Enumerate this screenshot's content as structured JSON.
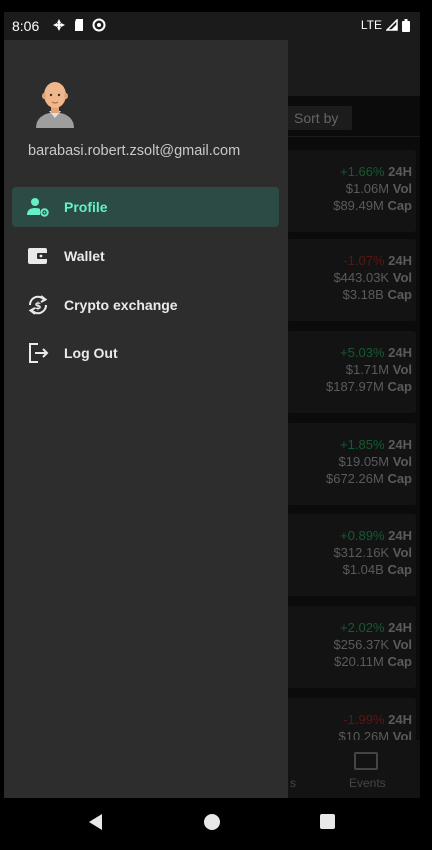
{
  "status_bar": {
    "time": "8:06",
    "network": "LTE"
  },
  "drawer": {
    "email": "barabasi.robert.zsolt@gmail.com",
    "items": [
      {
        "label": "Profile",
        "icon": "profile-settings-icon",
        "active": true
      },
      {
        "label": "Wallet",
        "icon": "wallet-icon",
        "active": false
      },
      {
        "label": "Crypto exchange",
        "icon": "crypto-exchange-icon",
        "active": false
      },
      {
        "label": "Log Out",
        "icon": "logout-icon",
        "active": false
      }
    ]
  },
  "background": {
    "sort_by": "Sort by",
    "cards": [
      {
        "change": "+1.66%",
        "trend": "up",
        "vol": "$1.06M",
        "cap": "$89.49M"
      },
      {
        "change": "-1.07%",
        "trend": "down",
        "vol": "$443.03K",
        "cap": "$3.18B"
      },
      {
        "change": "+5.03%",
        "trend": "up",
        "vol": "$1.71M",
        "cap": "$187.97M"
      },
      {
        "change": "+1.85%",
        "trend": "up",
        "vol": "$19.05M",
        "cap": "$672.26M"
      },
      {
        "change": "+0.89%",
        "trend": "up",
        "vol": "$312.16K",
        "cap": "$1.04B"
      },
      {
        "change": "+2.02%",
        "trend": "up",
        "vol": "$256.37K",
        "cap": "$20.11M"
      },
      {
        "change": "-1.99%",
        "trend": "down",
        "vol": "$10.26M",
        "cap": ""
      }
    ],
    "labels": {
      "h24": "24H",
      "vol": "Vol",
      "cap": "Cap"
    },
    "bottom_nav": {
      "partial_label": "s",
      "events_label": "Events"
    }
  },
  "colors": {
    "accent": "#64f0c8",
    "active_bg": "#2c4b44",
    "positive": "#1f8a4c",
    "negative": "#8a2222"
  }
}
